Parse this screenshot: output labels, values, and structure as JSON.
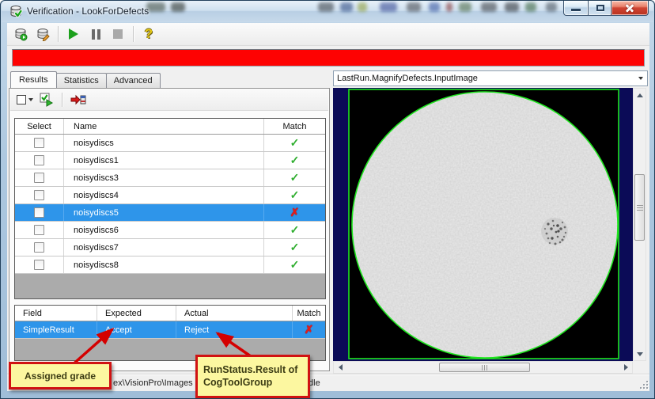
{
  "window": {
    "title": "Verification - LookForDefects",
    "icon": "database-check-icon"
  },
  "titlebar_buttons": {
    "minimize": "minimize",
    "maximize": "maximize",
    "close": "close"
  },
  "main_toolbar": {
    "items": [
      {
        "name": "database-run",
        "icon": "database-play-icon"
      },
      {
        "name": "database-edit",
        "icon": "database-edit-icon"
      },
      {
        "name": "run",
        "icon": "play-icon"
      },
      {
        "name": "pause",
        "icon": "pause-icon"
      },
      {
        "name": "stop",
        "icon": "stop-icon"
      },
      {
        "name": "help",
        "icon": "help-icon",
        "glyph": "?"
      }
    ]
  },
  "alert_banner": {
    "color": "#fe0202"
  },
  "tabs": [
    {
      "label": "Results",
      "active": true
    },
    {
      "label": "Statistics",
      "active": false
    },
    {
      "label": "Advanced",
      "active": false
    }
  ],
  "results_toolbar": {
    "items": [
      {
        "name": "select-dropdown",
        "icon": "checkbox-dropdown-icon"
      },
      {
        "name": "run-checked",
        "icon": "checkbox-run-icon"
      },
      {
        "name": "send-to-database",
        "icon": "red-arrow-database-icon"
      }
    ]
  },
  "results_table": {
    "columns": [
      "Select",
      "Name",
      "Match"
    ],
    "rows": [
      {
        "name": "noisydiscs",
        "match": "pass",
        "match_glyph": "✓",
        "selected": false
      },
      {
        "name": "noisydiscs1",
        "match": "pass",
        "match_glyph": "✓",
        "selected": false
      },
      {
        "name": "noisydiscs3",
        "match": "pass",
        "match_glyph": "✓",
        "selected": false
      },
      {
        "name": "noisydiscs4",
        "match": "pass",
        "match_glyph": "✓",
        "selected": false
      },
      {
        "name": "noisydiscs5",
        "match": "fail",
        "match_glyph": "✗",
        "selected": true
      },
      {
        "name": "noisydiscs6",
        "match": "pass",
        "match_glyph": "✓",
        "selected": false
      },
      {
        "name": "noisydiscs7",
        "match": "pass",
        "match_glyph": "✓",
        "selected": false
      },
      {
        "name": "noisydiscs8",
        "match": "pass",
        "match_glyph": "✓",
        "selected": false
      }
    ]
  },
  "detail_table": {
    "columns": [
      "Field",
      "Expected",
      "Actual",
      "Match"
    ],
    "rows": [
      {
        "field": "SimpleResult",
        "expected": "Accept",
        "actual": "Reject",
        "match": "fail",
        "match_glyph": "✗",
        "selected": true
      }
    ]
  },
  "image_panel": {
    "selector_value": "LastRun.MagnifyDefects.InputImage",
    "colors": {
      "background": "#0b0b57",
      "image_bg": "#000000",
      "graphics_overlay": "#1ee51e"
    }
  },
  "status_bar": {
    "path_text": "ex\\VisionPro\\Images",
    "state_text": "Idle"
  },
  "callouts": [
    {
      "text": "Assigned grade"
    },
    {
      "text": "RunStatus.Result of CogToolGroup"
    }
  ],
  "colors": {
    "selection": "#2e95ea",
    "pass": "#2fae2f",
    "fail": "#e21c1c",
    "callout_bg": "#fcf7a0",
    "callout_border": "#d01212"
  }
}
